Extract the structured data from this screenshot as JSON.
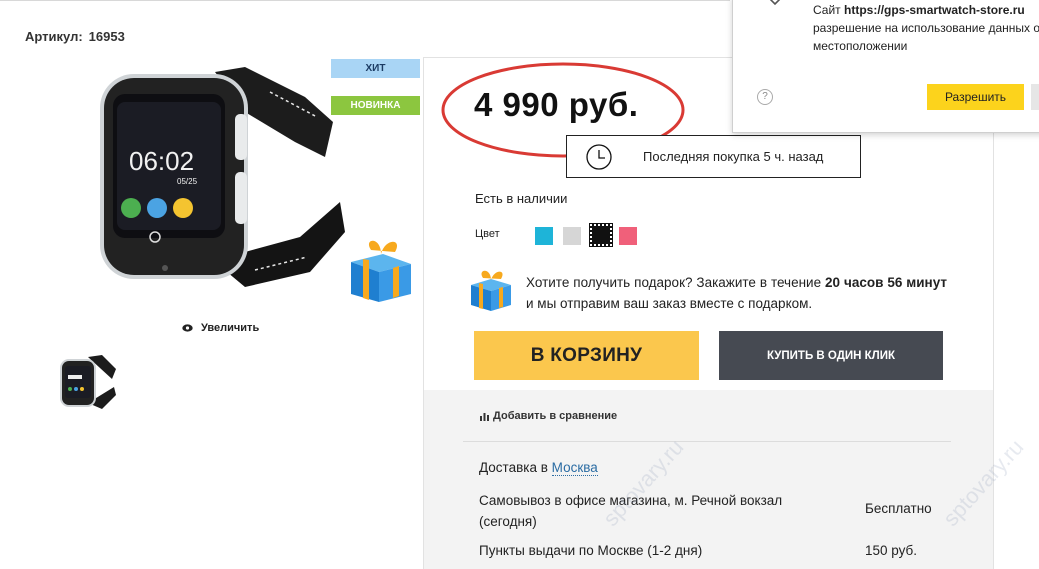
{
  "sku": {
    "label": "Артикул:",
    "value": "16953"
  },
  "badges": {
    "hit": "ХИТ",
    "new": "НОВИНКА"
  },
  "gallery": {
    "watch_time": "06:02",
    "watch_date": "05/25",
    "zoom_label": "Увеличить"
  },
  "product": {
    "price": "4 990 руб.",
    "last_purchase": "Последняя покупка 5 ч. назад",
    "stock": "Есть в наличии",
    "color_label": "Цвет",
    "swatches": [
      "#1eb4d8",
      "#d6d6d6",
      "#111111",
      "#f0607a"
    ]
  },
  "promo": {
    "text_before": "Хотите получить подарок? Закажите в течение ",
    "hours": "20 часов 56 минут",
    "text_after": " и мы отправим ваш заказ вместе с подарком."
  },
  "buttons": {
    "cart": "В КОРЗИНУ",
    "one_click": "КУПИТЬ В ОДИН КЛИК",
    "compare": "Добавить в сравнение"
  },
  "delivery": {
    "title_prefix": "Доставка в",
    "city": "Москва",
    "pickup_label": "Самовывоз в офисе магазина, м. Речной вокзал (сегодня)",
    "pickup_price": "Бесплатно",
    "points_label": "Пункты выдачи по Москве (1-2 дня)",
    "points_price": "150 руб."
  },
  "popup": {
    "site_prefix": "Сайт",
    "site_url": "https://gps-smartwatch-store.ru",
    "message": "разрешение на использование данных о местоположении",
    "allow": "Разрешить",
    "help": "?"
  },
  "watermark": "sptovary.ru",
  "colors": {
    "price_ring": "#d93a34",
    "cart_bg": "#fbc74d",
    "oneclick_bg": "#464a52",
    "popup_allow": "#fcd31c"
  }
}
